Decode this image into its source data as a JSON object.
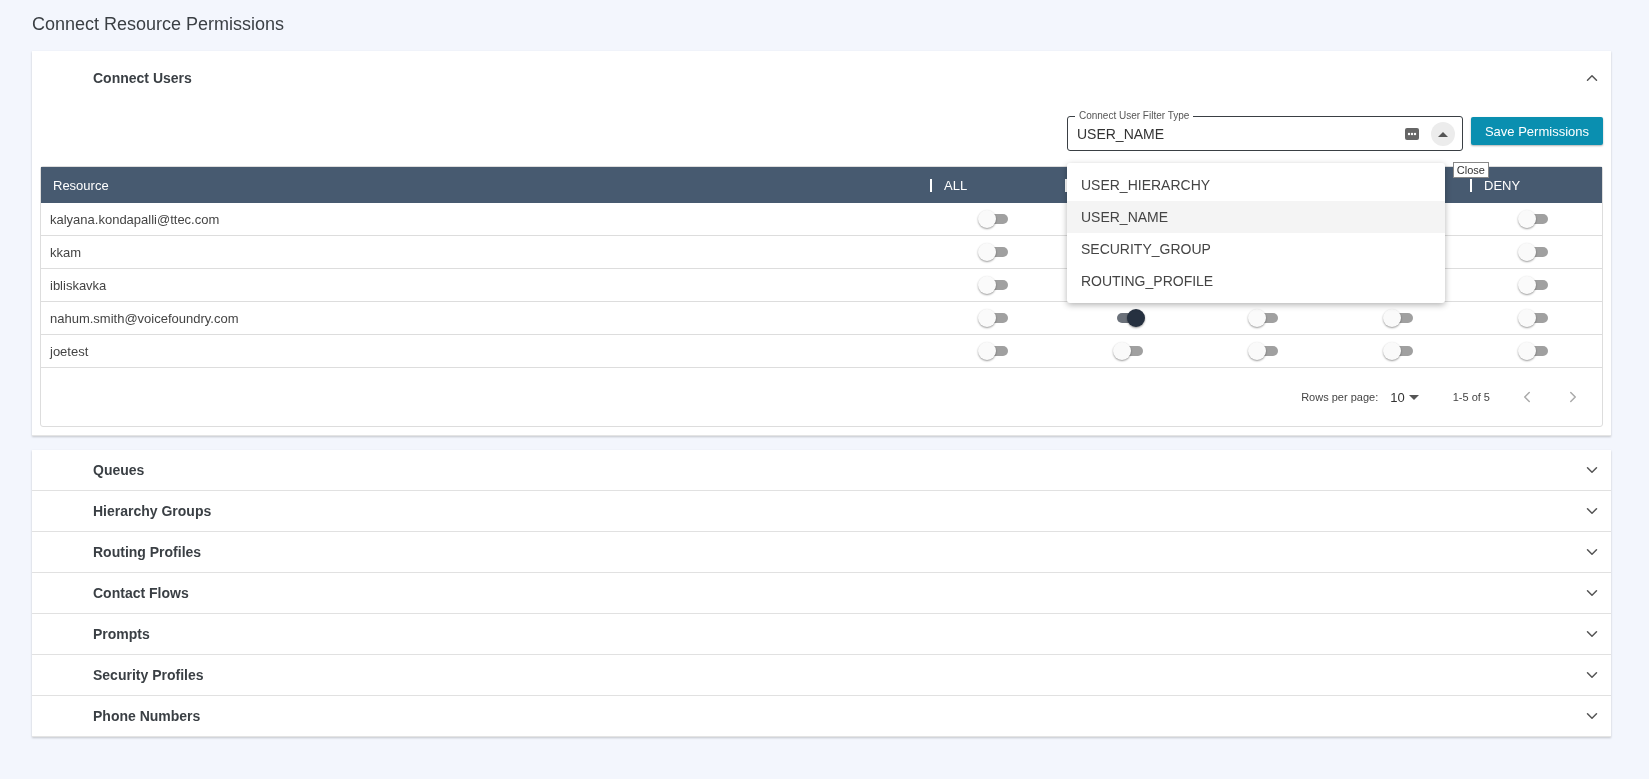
{
  "page_title": "Connect Resource Permissions",
  "sections": [
    {
      "title": "Connect Users",
      "expanded": true
    },
    {
      "title": "Queues",
      "expanded": false
    },
    {
      "title": "Hierarchy Groups",
      "expanded": false
    },
    {
      "title": "Routing Profiles",
      "expanded": false
    },
    {
      "title": "Contact Flows",
      "expanded": false
    },
    {
      "title": "Prompts",
      "expanded": false
    },
    {
      "title": "Security Profiles",
      "expanded": false
    },
    {
      "title": "Phone Numbers",
      "expanded": false
    }
  ],
  "filter": {
    "label": "Connect User Filter Type",
    "value": "USER_NAME",
    "open": true,
    "options": [
      {
        "label": "USER_HIERARCHY",
        "selected": false
      },
      {
        "label": "USER_NAME",
        "selected": true
      },
      {
        "label": "SECURITY_GROUP",
        "selected": false
      },
      {
        "label": "ROUTING_PROFILE",
        "selected": false
      }
    ],
    "tooltip": "Close"
  },
  "save_button": "Save Permissions",
  "table": {
    "columns": [
      "Resource",
      "ALL",
      "DENY"
    ],
    "rows": [
      {
        "resource": "kalyana.kondapalli@ttec.com",
        "toggles": [
          {
            "kind": "all",
            "on": false
          },
          {
            "kind": "deny",
            "on": false
          }
        ]
      },
      {
        "resource": "kkam",
        "toggles": [
          {
            "kind": "all",
            "on": false
          },
          {
            "kind": "deny",
            "on": false
          }
        ]
      },
      {
        "resource": "ibliskavka",
        "toggles": [
          {
            "kind": "all",
            "on": false
          },
          {
            "kind": "deny",
            "on": false
          }
        ]
      },
      {
        "resource": "nahum.smith@voicefoundry.com",
        "toggles": [
          {
            "kind": "all",
            "on": false
          },
          {
            "kind": "mid",
            "on": true
          },
          {
            "kind": "mid",
            "on": false
          },
          {
            "kind": "mid",
            "on": false
          },
          {
            "kind": "deny",
            "on": false
          }
        ]
      },
      {
        "resource": "joetest",
        "toggles": [
          {
            "kind": "all",
            "on": false
          },
          {
            "kind": "mid",
            "on": false
          },
          {
            "kind": "mid",
            "on": false
          },
          {
            "kind": "mid",
            "on": false
          },
          {
            "kind": "deny",
            "on": false
          }
        ]
      }
    ]
  },
  "pagination": {
    "rows_per_page_label": "Rows per page:",
    "rows_per_page": "10",
    "range": "1-5 of 5"
  }
}
